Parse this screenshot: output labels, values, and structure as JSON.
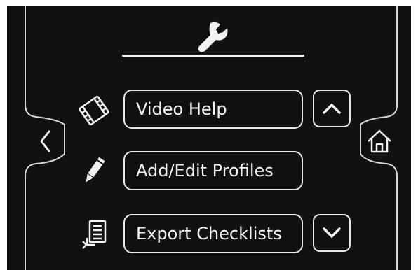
{
  "header": {
    "icon": "wrench-icon"
  },
  "menu": {
    "items": [
      {
        "label": "Video Help",
        "icon": "film-icon"
      },
      {
        "label": "Add/Edit Profiles",
        "icon": "pencil-icon"
      },
      {
        "label": "Export Checklists",
        "icon": "export-document-icon"
      }
    ]
  },
  "nav": {
    "back_icon": "chevron-left-icon",
    "home_icon": "home-icon",
    "scroll_up_icon": "chevron-up-icon",
    "scroll_down_icon": "chevron-down-icon"
  },
  "colors": {
    "background": "#111111",
    "foreground": "#f2f2f2",
    "border": "#e8e8e8"
  }
}
